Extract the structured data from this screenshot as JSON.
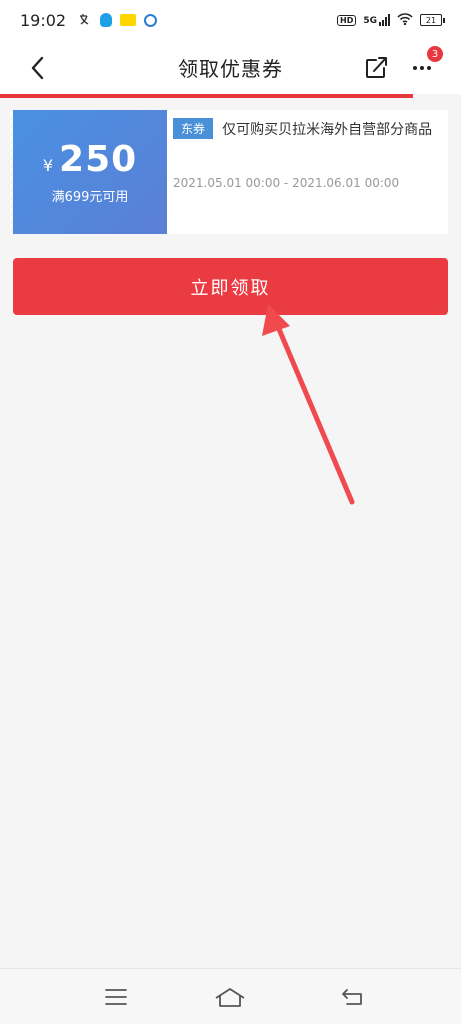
{
  "status_bar": {
    "time": "19:02",
    "network": "5G",
    "battery": "21",
    "hd": "HD"
  },
  "header": {
    "title": "领取优惠券",
    "badge_count": "3"
  },
  "coupon": {
    "currency": "¥",
    "amount": "250",
    "condition": "满699元可用",
    "tag": "东券",
    "description": "仅可购买贝拉米海外自营部分商品",
    "validity": "2021.05.01 00:00 - 2021.06.01 00:00"
  },
  "claim_button": {
    "label": "立即领取"
  },
  "colors": {
    "accent_red": "#ea3a42",
    "coupon_blue": "#4a90e2",
    "tag_blue": "#4a90d9"
  },
  "icons": {
    "back": "chevron-left-icon",
    "share": "share-icon",
    "more": "more-dots-icon",
    "menu": "menu-icon",
    "home": "home-icon",
    "return": "back-arrow-icon"
  }
}
